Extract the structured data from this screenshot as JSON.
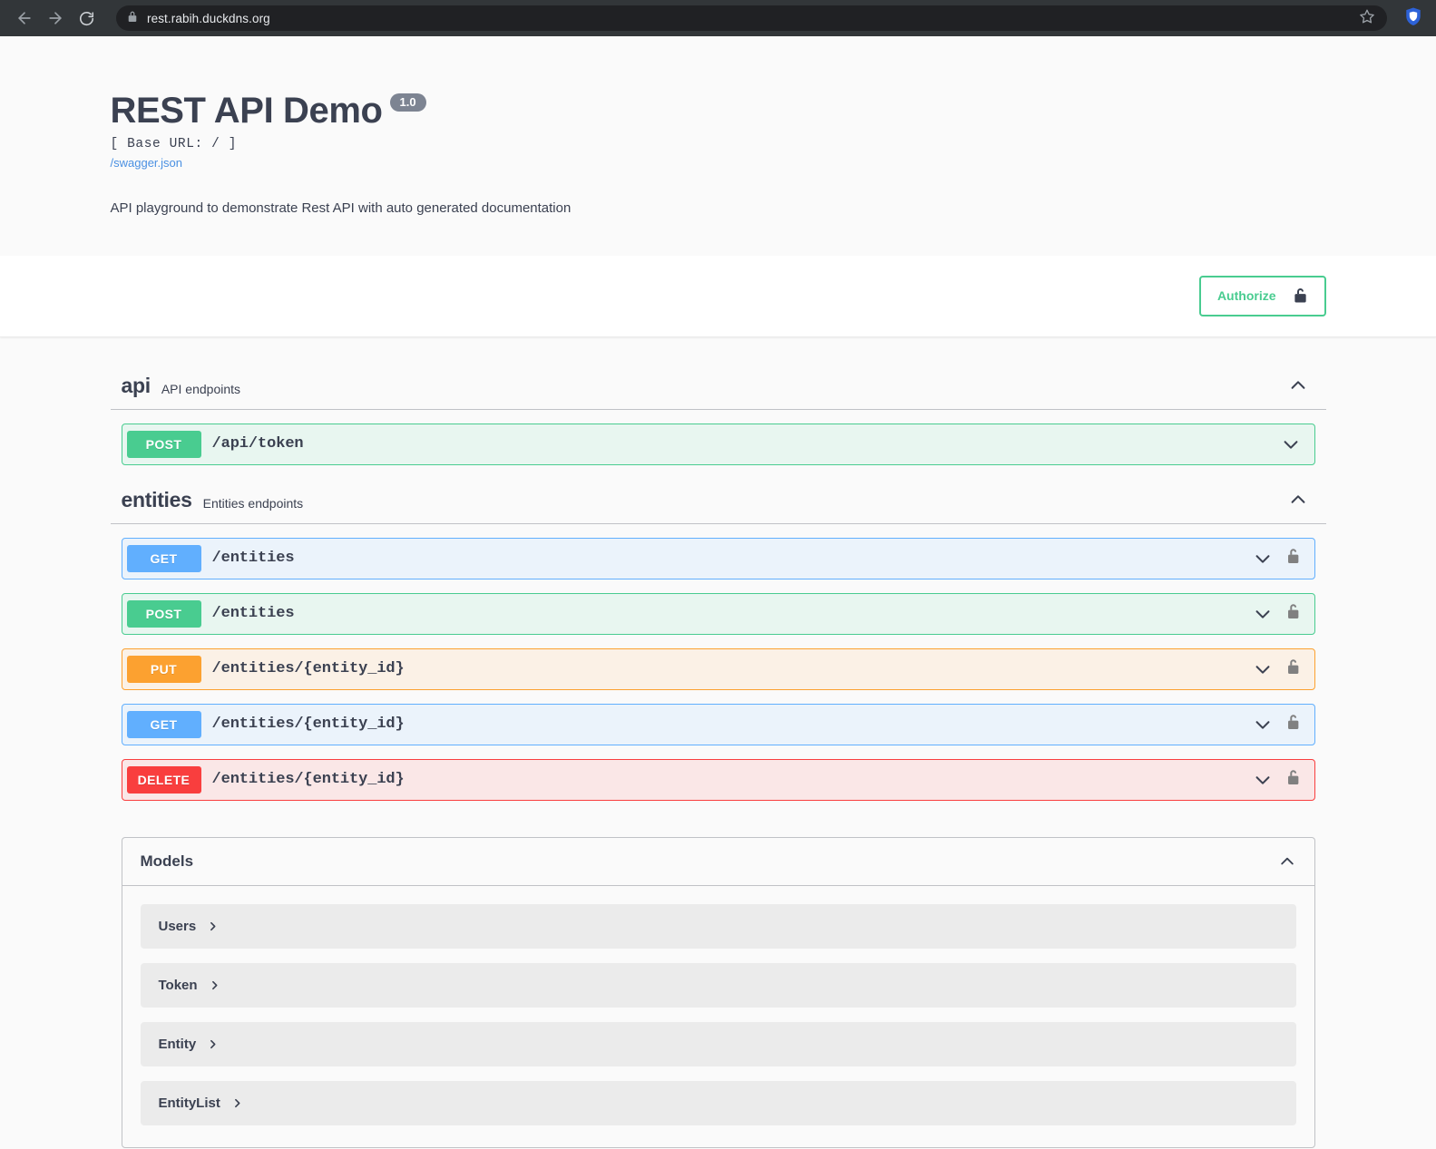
{
  "browser": {
    "back_icon": "arrow-left-icon",
    "forward_icon": "arrow-right-icon",
    "reload_icon": "reload-icon",
    "lock_icon": "padlock-icon",
    "url": "rest.rabih.duckdns.org",
    "bookmark_icon": "star-icon",
    "extension_icon": "shield-extension-icon",
    "chrome_bg": "#323639",
    "omnibox_bg": "#202124"
  },
  "info": {
    "title": "REST API Demo",
    "version": "1.0",
    "base_url": "[ Base URL: / ]",
    "spec_link": "/swagger.json",
    "description": "API playground to demonstrate Rest API with auto generated documentation"
  },
  "scheme": {
    "authorize_label": "Authorize",
    "authorize_icon": "unlock-icon",
    "accent_color": "#49cc90"
  },
  "tags": [
    {
      "name": "api",
      "description": "API endpoints",
      "collapse_icon": "chevron-up-icon",
      "operations": [
        {
          "method": "POST",
          "method_class": "post",
          "path": "/api/token",
          "expand_icon": "chevron-down-icon",
          "has_lock": false
        }
      ]
    },
    {
      "name": "entities",
      "description": "Entities endpoints",
      "collapse_icon": "chevron-up-icon",
      "operations": [
        {
          "method": "GET",
          "method_class": "get",
          "path": "/entities",
          "expand_icon": "chevron-down-icon",
          "has_lock": true,
          "lock_icon": "unlock-icon"
        },
        {
          "method": "POST",
          "method_class": "post",
          "path": "/entities",
          "expand_icon": "chevron-down-icon",
          "has_lock": true,
          "lock_icon": "unlock-icon"
        },
        {
          "method": "PUT",
          "method_class": "put",
          "path": "/entities/{entity_id}",
          "expand_icon": "chevron-down-icon",
          "has_lock": true,
          "lock_icon": "unlock-icon"
        },
        {
          "method": "GET",
          "method_class": "get",
          "path": "/entities/{entity_id}",
          "expand_icon": "chevron-down-icon",
          "has_lock": true,
          "lock_icon": "unlock-icon"
        },
        {
          "method": "DELETE",
          "method_class": "delete",
          "path": "/entities/{entity_id}",
          "expand_icon": "chevron-down-icon",
          "has_lock": true,
          "lock_icon": "unlock-icon"
        }
      ]
    }
  ],
  "models": {
    "title": "Models",
    "collapse_icon": "chevron-up-icon",
    "items": [
      {
        "name": "Users",
        "expand_icon": "chevron-right-icon"
      },
      {
        "name": "Token",
        "expand_icon": "chevron-right-icon"
      },
      {
        "name": "Entity",
        "expand_icon": "chevron-right-icon"
      },
      {
        "name": "EntityList",
        "expand_icon": "chevron-right-icon"
      }
    ]
  },
  "method_colors": {
    "GET": "#61affe",
    "POST": "#49cc90",
    "PUT": "#fca130",
    "DELETE": "#f93e3e"
  }
}
